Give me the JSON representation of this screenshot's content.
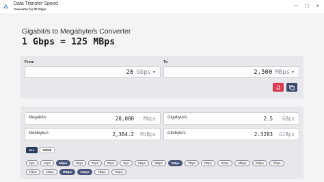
{
  "app": {
    "title": "Data Transfer Speed",
    "subtitle": "Converter for 20 Gbps"
  },
  "main": {
    "heading": "Gigabit/s to Megabyte/s Converter",
    "result": "1 Gbps = 125 MBps"
  },
  "converter": {
    "from_label": "From",
    "to_label": "To",
    "from_value": "20",
    "from_unit": "Gbps",
    "to_value": "2,500",
    "to_unit": "MBps"
  },
  "results": [
    {
      "label": "Megabit/s",
      "value": "20,000",
      "unit": "Mbps"
    },
    {
      "label": "Gigabyte/s",
      "value": "2.5",
      "unit": "GBps"
    },
    {
      "label": "Mebibyte/s",
      "value": "2,384.2",
      "unit": "MiBps"
    },
    {
      "label": "Gibibyte/s",
      "value": "2.3283",
      "unit": "GiBps"
    }
  ],
  "filters": {
    "all_label": "ALL",
    "none_label": "NONE",
    "units": [
      {
        "label": "bps",
        "on": false
      },
      {
        "label": "Kbps",
        "on": false
      },
      {
        "label": "Mbps",
        "on": true
      },
      {
        "label": "Gbps",
        "on": false
      },
      {
        "label": "Tbps",
        "on": false
      },
      {
        "label": "Pbps",
        "on": false
      },
      {
        "label": "Bps",
        "on": false
      },
      {
        "label": "KBps",
        "on": false
      },
      {
        "label": "MBps",
        "on": false
      },
      {
        "label": "GBps",
        "on": true
      },
      {
        "label": "TBps",
        "on": false
      },
      {
        "label": "PBps",
        "on": false
      },
      {
        "label": "Kibps",
        "on": false
      },
      {
        "label": "Mibps",
        "on": false
      },
      {
        "label": "Gibps",
        "on": false
      },
      {
        "label": "Tibps",
        "on": false
      },
      {
        "label": "Pibps",
        "on": false
      },
      {
        "label": "KiBps",
        "on": false
      },
      {
        "label": "MiBps",
        "on": true
      },
      {
        "label": "GiBps",
        "on": true
      },
      {
        "label": "TiBps",
        "on": false
      },
      {
        "label": "PiBps",
        "on": false
      }
    ]
  }
}
